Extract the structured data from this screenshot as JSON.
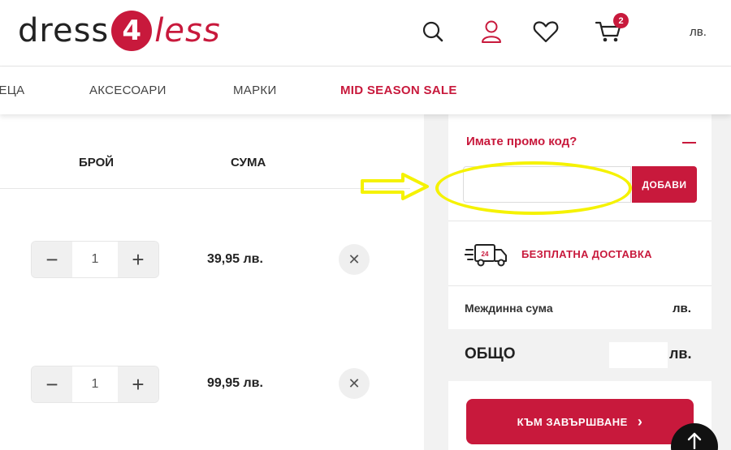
{
  "header": {
    "logo": {
      "part1": "dress",
      "part2": "4",
      "part3": "less"
    },
    "icons": [
      "search-icon",
      "user-icon",
      "heart-icon",
      "cart-icon"
    ],
    "cart_count": "2",
    "currency": "лв."
  },
  "nav": {
    "items": [
      {
        "label": "ДЕЦА"
      },
      {
        "label": "АКСЕСОАРИ"
      },
      {
        "label": "МАРКИ"
      },
      {
        "label": "MID SEASON SALE",
        "accent": true
      }
    ]
  },
  "cart": {
    "columns": {
      "qty": "БРОЙ",
      "sum": "СУМА"
    },
    "rows": [
      {
        "qty": "1",
        "price": "39,95 лв."
      },
      {
        "qty": "1",
        "price": "99,95 лв."
      }
    ],
    "minus_symbol": "−",
    "plus_symbol": "+",
    "remove_symbol": "✕"
  },
  "summary": {
    "promo_title": "Имате промо код?",
    "promo_placeholder": "",
    "promo_button": "ДОБАВИ",
    "delivery_badge": "24",
    "delivery_text": "БЕЗПЛАТНА ДОСТАВКА",
    "subtotal_label": "Междинна сума",
    "subtotal_value": "лв.",
    "total_label": "ОБЩО",
    "total_value": "лв.",
    "checkout_label": "КЪМ ЗАВЪРШВАНЕ",
    "checkout_chevron": "›"
  },
  "colors": {
    "brand": "#c8193c",
    "annotation": "#f5f200",
    "panel_bg": "#f2f2f2"
  }
}
